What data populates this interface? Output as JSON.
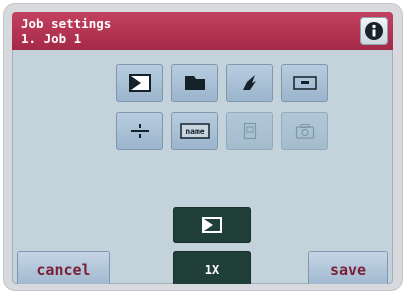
{
  "header": {
    "title": "Job settings",
    "subtitle": "1. Job 1",
    "info_icon": "info-icon"
  },
  "settings_grid": {
    "row1": [
      {
        "icon": "envelope-flap-icon",
        "state": "active"
      },
      {
        "icon": "document-folder-icon",
        "state": "active"
      },
      {
        "icon": "sealing-icon",
        "state": "active"
      },
      {
        "icon": "envelope-window-icon",
        "state": "active"
      }
    ],
    "row2": [
      {
        "icon": "separator-icon",
        "state": "active"
      },
      {
        "icon": "name-label-icon",
        "label": "name",
        "state": "active"
      },
      {
        "icon": "document-icon",
        "state": "disabled"
      },
      {
        "icon": "camera-icon",
        "state": "disabled"
      }
    ]
  },
  "controls": {
    "envelope_button_icon": "envelope-flap-icon",
    "count_label": "1X",
    "cancel_label": "cancel",
    "save_label": "save"
  },
  "colors": {
    "title_bar": "#b33352",
    "screen_bg": "#c4d2dc",
    "dark_button": "#1f3f38",
    "button_text": "#7a2038"
  }
}
